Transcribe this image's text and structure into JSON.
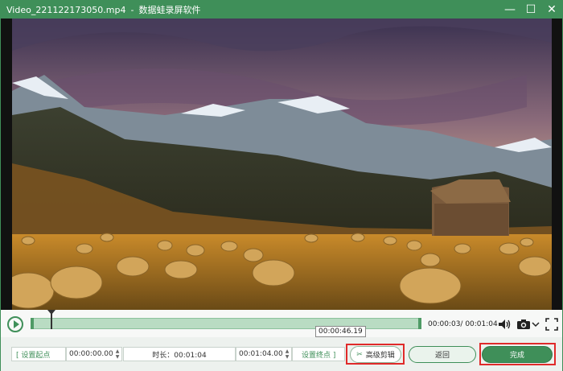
{
  "window": {
    "file_name": "Video_221122173050.mp4",
    "separator": "-",
    "app_name": "数据蛙录屏软件",
    "controls": {
      "minimize": "—",
      "maximize": "☐",
      "close": "✕"
    }
  },
  "player": {
    "hover_time": "00:00:46.19",
    "time_readout": "00:00:03/ 00:01:04"
  },
  "trim": {
    "set_start_label": "[  设置起点",
    "start_time": "00:00:00.00",
    "duration_label": "时长：00:01:04",
    "end_time": "00:01:04.00",
    "set_end_label": "设置终点  ]",
    "advanced_label": "高级剪辑",
    "back_label": "返回",
    "done_label": "完成"
  },
  "colors": {
    "accent": "#3f8f59",
    "highlight": "#e02a2a"
  },
  "icons": [
    "minimize-icon",
    "maximize-icon",
    "close-icon",
    "play-icon",
    "volume-icon",
    "camera-icon",
    "chevron-down-icon",
    "fullscreen-icon",
    "scissors-icon"
  ]
}
